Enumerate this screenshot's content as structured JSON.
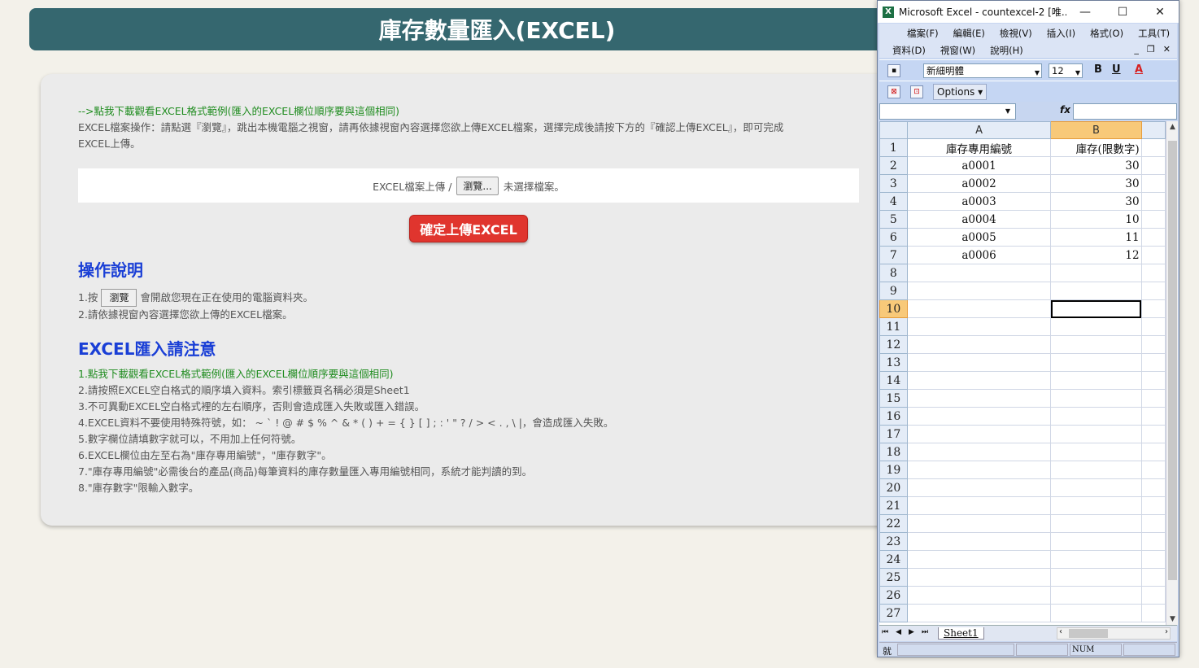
{
  "page": {
    "title": "庫存數量匯入(EXCEL)",
    "download_link": "-->點我下載觀看EXCEL格式範例(匯入的EXCEL欄位順序要與這個相同)",
    "instructions_line1": "EXCEL檔案操作：請點選『瀏覽』，跳出本機電腦之視窗，請再依據視窗內容選擇您欲上傳EXCEL檔案，選擇完成後請按下方的『確認上傳EXCEL』，即可完成",
    "instructions_line2": "EXCEL上傳。",
    "upload_label": "EXCEL檔案上傳 /",
    "browse_button": "瀏覽...",
    "no_file_text": "未選擇檔案。",
    "confirm_button": "確定上傳EXCEL",
    "ops_heading": "操作說明",
    "ops_1_prefix": "1.按",
    "ops_1_button": "瀏覽",
    "ops_1_suffix": "會開啟您現在正在使用的電腦資料夾。",
    "ops_2": "2.請依據視窗內容選擇您欲上傳的EXCEL檔案。",
    "notes_heading": "EXCEL匯入請注意",
    "notes": [
      "1.點我下載觀看EXCEL格式範例(匯入的EXCEL欄位順序要與這個相同)",
      "2.請按照EXCEL空白格式的順序填入資料。索引標籤頁名稱必須是Sheet1",
      "3.不可異動EXCEL空白格式裡的左右順序，否則會造成匯入失敗或匯入錯誤。",
      "4.EXCEL資料不要使用特殊符號，如： ~ ` ! @ # $ % ^ & * ( ) + = { } [ ] ; : ' \" ? / > < . , \\ |，會造成匯入失敗。",
      "5.數字欄位請填數字就可以，不用加上任何符號。",
      "6.EXCEL欄位由左至右為\"庫存專用編號\"，\"庫存數字\"。",
      "7.\"庫存專用編號\"必需後台的產品(商品)每筆資料的庫存數量匯入專用編號相同，系統才能判讀的到。",
      "8.\"庫存數字\"限輸入數字。"
    ]
  },
  "excel": {
    "window_title": "Microsoft Excel - countexcel-2  [唯...",
    "logo": "X",
    "win_minimize": "—",
    "win_maximize": "☐",
    "win_close": "✕",
    "menu_row1": [
      "檔案(F)",
      "編輯(E)",
      "檢視(V)",
      "插入(I)",
      "格式(O)",
      "工具(T)"
    ],
    "menu_row2": [
      "資料(D)",
      "視窗(W)",
      "說明(H)"
    ],
    "doc_controls": [
      "_",
      "❐",
      "✕"
    ],
    "font_name": "新細明體",
    "font_size": "12",
    "bold": "B",
    "underline": "U",
    "font_color": "A",
    "options_button": "Options ▾",
    "fx_label": "fx",
    "columns": [
      "A",
      "B"
    ],
    "rows": [
      {
        "n": "1",
        "a": "庫存專用編號",
        "b": "庫存(限數字)"
      },
      {
        "n": "2",
        "a": "a0001",
        "b": "30"
      },
      {
        "n": "3",
        "a": "a0002",
        "b": "30"
      },
      {
        "n": "4",
        "a": "a0003",
        "b": "30"
      },
      {
        "n": "5",
        "a": "a0004",
        "b": "10"
      },
      {
        "n": "6",
        "a": "a0005",
        "b": "11"
      },
      {
        "n": "7",
        "a": "a0006",
        "b": "12"
      },
      {
        "n": "8",
        "a": "",
        "b": ""
      },
      {
        "n": "9",
        "a": "",
        "b": ""
      },
      {
        "n": "10",
        "a": "",
        "b": ""
      },
      {
        "n": "11",
        "a": "",
        "b": ""
      },
      {
        "n": "12",
        "a": "",
        "b": ""
      },
      {
        "n": "13",
        "a": "",
        "b": ""
      },
      {
        "n": "14",
        "a": "",
        "b": ""
      },
      {
        "n": "15",
        "a": "",
        "b": ""
      },
      {
        "n": "16",
        "a": "",
        "b": ""
      },
      {
        "n": "17",
        "a": "",
        "b": ""
      },
      {
        "n": "18",
        "a": "",
        "b": ""
      },
      {
        "n": "19",
        "a": "",
        "b": ""
      },
      {
        "n": "20",
        "a": "",
        "b": ""
      },
      {
        "n": "21",
        "a": "",
        "b": ""
      },
      {
        "n": "22",
        "a": "",
        "b": ""
      },
      {
        "n": "23",
        "a": "",
        "b": ""
      },
      {
        "n": "24",
        "a": "",
        "b": ""
      },
      {
        "n": "25",
        "a": "",
        "b": ""
      },
      {
        "n": "26",
        "a": "",
        "b": ""
      },
      {
        "n": "27",
        "a": "",
        "b": ""
      }
    ],
    "active_row": "10",
    "sheet_tab": "Sheet1",
    "status_ready": "就",
    "status_num": "NUM",
    "tab_nav": [
      "⏮",
      "◀",
      "▶",
      "⏭"
    ]
  },
  "colors": {
    "header_bg": "#35676f",
    "confirm_red": "#e0352e",
    "heading_blue": "#1a3fd6",
    "link_green": "#1f8c1f"
  }
}
